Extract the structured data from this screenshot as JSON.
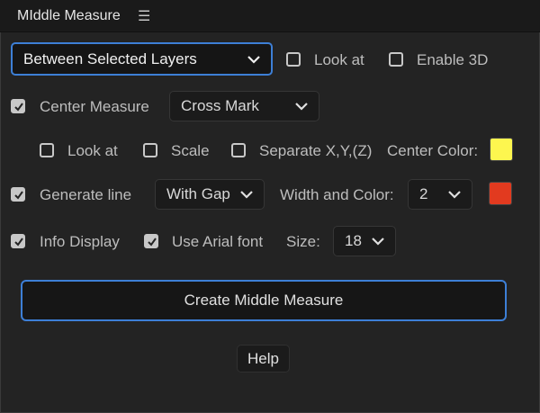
{
  "header": {
    "title": "MIddle Measure",
    "menu_icon": "hamburger-menu-icon"
  },
  "measure_mode": {
    "selected": "Between Selected Layers"
  },
  "top_options": {
    "look_at": "Look at",
    "enable_3d": "Enable 3D",
    "look_at_checked": false,
    "enable_3d_checked": false
  },
  "center_measure": {
    "label": "Center Measure",
    "checked": true,
    "style": "Cross Mark",
    "look_at": "Look at",
    "look_at_checked": false,
    "scale": "Scale",
    "scale_checked": false,
    "separate": "Separate X,Y,(Z)",
    "separate_checked": false,
    "color_label": "Center Color:",
    "color": "#fdf64f"
  },
  "generate_line": {
    "label": "Generate line",
    "checked": true,
    "style": "With Gap",
    "width_color_label": "Width and Color:",
    "width": "2",
    "color": "#e23a1f"
  },
  "info_display": {
    "label": "Info Display",
    "checked": true,
    "arial_label": "Use Arial font",
    "arial_checked": true,
    "size_label": "Size:",
    "size": "18"
  },
  "buttons": {
    "create": "Create Middle Measure",
    "help": "Help"
  },
  "colors": {
    "accent": "#3d7fd6",
    "background": "#232323"
  }
}
